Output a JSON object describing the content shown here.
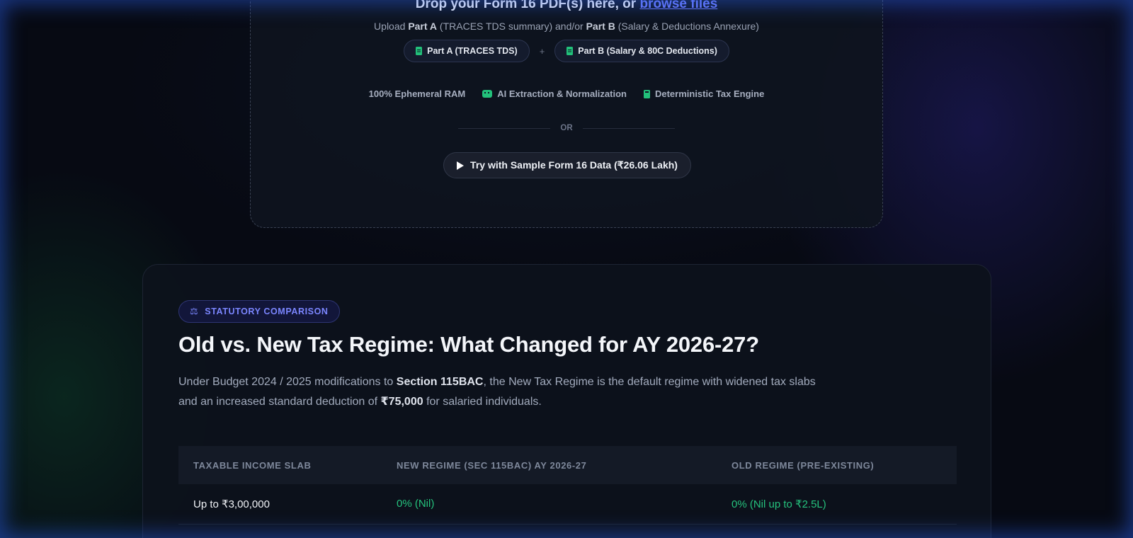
{
  "upload": {
    "title_prefix": "Drop your Form 16 PDF(s) here, or ",
    "browse_link": "browse files",
    "subtitle_upload": "Upload ",
    "subtitle_part_a": "Part A",
    "subtitle_mid": " (TRACES TDS summary) and/or ",
    "subtitle_part_b": "Part B",
    "subtitle_end": " (Salary & Deductions Annexure)",
    "pill_a": "Part A (TRACES TDS)",
    "plus": "+",
    "pill_b": "Part B (Salary & 80C Deductions)",
    "features": [
      "100% Ephemeral RAM",
      "AI Extraction & Normalization",
      "Deterministic Tax Engine"
    ],
    "or_label": "OR",
    "sample_button": "Try with Sample Form 16 Data (₹26.06 Lakh)"
  },
  "comparison": {
    "badge": "STATUTORY COMPARISON",
    "title": "Old vs. New Tax Regime: What Changed for AY 2026-27?",
    "desc_1": "Under Budget 2024 / 2025 modifications to ",
    "desc_section": "Section 115BAC",
    "desc_2": ", the New Tax Regime is the default regime with widened tax slabs and an increased standard deduction of ",
    "desc_amount": "₹75,000",
    "desc_3": " for salaried individuals.",
    "table": {
      "headers": [
        "TAXABLE INCOME SLAB",
        "NEW REGIME (SEC 115BAC) AY 2026-27",
        "OLD REGIME (PRE-EXISTING)"
      ],
      "rows": [
        {
          "slab": "Up to ₹3,00,000",
          "new_regime": "0% (Nil)",
          "old_regime": "0% (Nil up to ₹2.5L)"
        }
      ]
    }
  },
  "colors": {
    "accent_indigo": "#6d7cff",
    "accent_green": "#22c07a"
  }
}
